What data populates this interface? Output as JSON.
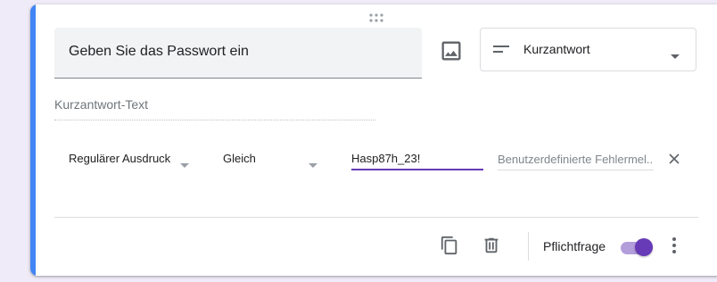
{
  "question": {
    "title": "Geben Sie das Passwort ein",
    "type_label": "Kurzantwort",
    "answer_placeholder": "Kurzantwort-Text"
  },
  "validation": {
    "rule_type": "Regulärer Ausdruck",
    "condition": "Gleich",
    "pattern_value": "Hasp87h_23!",
    "error_placeholder": "Benutzerdefinierte Fehlermel..."
  },
  "footer": {
    "required_label": "Pflichtfrage",
    "required_on": true
  },
  "colors": {
    "accent": "#4285f4",
    "primary": "#673ab7",
    "background": "#f0ebf8"
  },
  "icons": {
    "drag": "drag-handle-icon",
    "image": "image-icon",
    "short_answer": "short-answer-icon",
    "dropdown": "chevron-down-icon",
    "close": "close-icon",
    "copy": "copy-icon",
    "delete": "trash-icon",
    "more": "more-vert-icon"
  }
}
